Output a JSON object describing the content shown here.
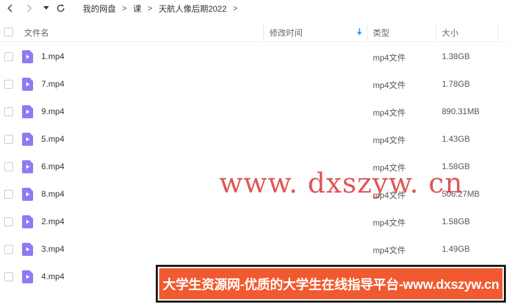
{
  "nav": {
    "back_icon": "chevron-left-icon",
    "forward_icon": "chevron-right-icon",
    "dropdown_icon": "caret-down-icon",
    "refresh_icon": "refresh-icon"
  },
  "breadcrumb": {
    "items": [
      "我的网盘",
      "课",
      "天航人像后期2022"
    ],
    "separator": ">"
  },
  "columns": {
    "name": "文件名",
    "modified": "修改时间",
    "type": "类型",
    "size": "大小",
    "sort_icon": "arrow-down-icon",
    "sort_color": "#1e90ff"
  },
  "files": [
    {
      "name": "1.mp4",
      "type": "mp4文件",
      "size": "1.38GB"
    },
    {
      "name": "7.mp4",
      "type": "mp4文件",
      "size": "1.78GB"
    },
    {
      "name": "9.mp4",
      "type": "mp4文件",
      "size": "890.31MB"
    },
    {
      "name": "5.mp4",
      "type": "mp4文件",
      "size": "1.43GB"
    },
    {
      "name": "6.mp4",
      "type": "mp4文件",
      "size": "1.58GB"
    },
    {
      "name": "8.mp4",
      "type": "mp4文件",
      "size": "506.27MB"
    },
    {
      "name": "2.mp4",
      "type": "mp4文件",
      "size": "1.58GB"
    },
    {
      "name": "3.mp4",
      "type": "mp4文件",
      "size": "1.49GB"
    },
    {
      "name": "4.mp4",
      "type": "",
      "size": ""
    }
  ],
  "file_icon_color": "#8b7cf6",
  "watermark": {
    "text": "www. dxszyw. cn",
    "color": "#d62828"
  },
  "banner": {
    "text": "大学生资源网-优质的大学生在线指导平台-www.dxszyw.cn",
    "background": "#f15a30"
  }
}
